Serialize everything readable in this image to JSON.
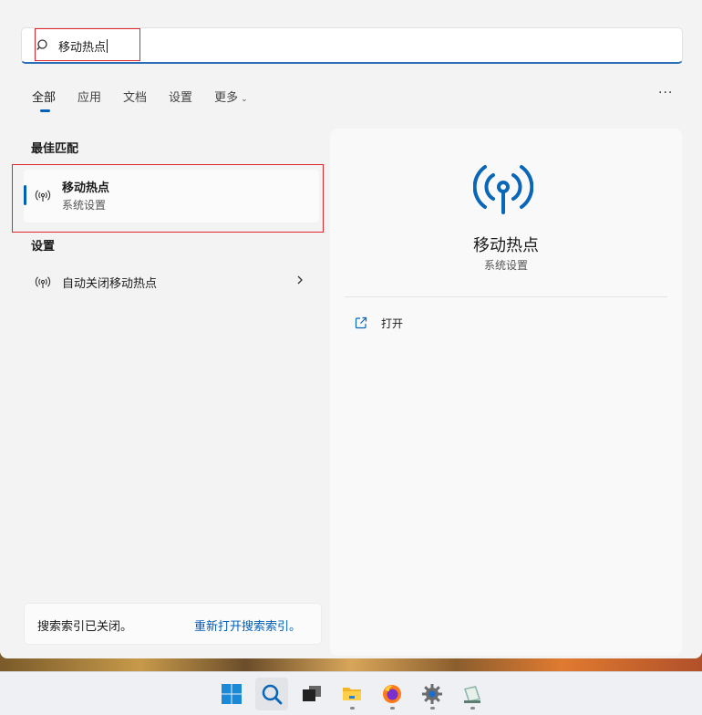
{
  "search": {
    "value": "移动热点",
    "placeholder": ""
  },
  "tabs": [
    {
      "label": "全部",
      "active": true
    },
    {
      "label": "应用",
      "active": false
    },
    {
      "label": "文档",
      "active": false
    },
    {
      "label": "设置",
      "active": false
    },
    {
      "label": "更多",
      "active": false
    }
  ],
  "more_options_label": "···",
  "best_match": {
    "section_title": "最佳匹配",
    "item": {
      "title": "移动热点",
      "subtitle": "系统设置",
      "icon": "hotspot-icon"
    }
  },
  "settings": {
    "section_title": "设置",
    "items": [
      {
        "label": "自动关闭移动热点",
        "icon": "hotspot-icon"
      }
    ]
  },
  "detail": {
    "name": "移动热点",
    "subtitle": "系统设置",
    "icon": "hotspot-icon",
    "actions": [
      {
        "label": "打开",
        "icon": "open-external-icon"
      }
    ]
  },
  "index_notice": {
    "message": "搜索索引已关闭。",
    "link": "重新打开搜索索引。"
  },
  "taskbar": {
    "apps": [
      {
        "name": "start",
        "icon": "windows-logo-icon"
      },
      {
        "name": "search",
        "icon": "search-icon"
      },
      {
        "name": "task-view",
        "icon": "task-view-icon"
      },
      {
        "name": "file-explorer",
        "icon": "folder-icon"
      },
      {
        "name": "firefox",
        "icon": "firefox-icon"
      },
      {
        "name": "settings",
        "icon": "gear-icon"
      },
      {
        "name": "app",
        "icon": "app-icon"
      }
    ]
  },
  "colors": {
    "accent": "#005fb8",
    "highlight_box": "#e0262b",
    "panel_bg": "#f3f3f3"
  }
}
